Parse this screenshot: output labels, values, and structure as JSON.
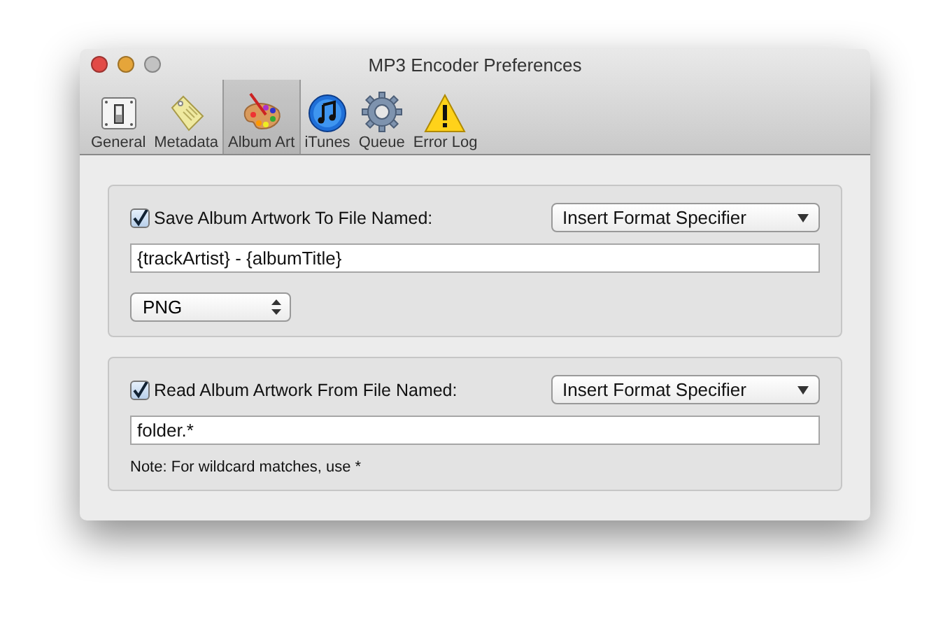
{
  "window": {
    "title": "MP3 Encoder Preferences"
  },
  "toolbar": {
    "items": [
      {
        "label": "General",
        "kind": "switch",
        "selected": false
      },
      {
        "label": "Metadata",
        "kind": "tag",
        "selected": false
      },
      {
        "label": "Album Art",
        "kind": "palette",
        "selected": true
      },
      {
        "label": "iTunes",
        "kind": "music",
        "selected": false
      },
      {
        "label": "Queue",
        "kind": "gear",
        "selected": false
      },
      {
        "label": "Error Log",
        "kind": "warning",
        "selected": false
      }
    ]
  },
  "sections": [
    {
      "checkbox": {
        "label": "Save Album Artwork To File Named:",
        "checked": true
      },
      "format_menu": {
        "label": "Insert Format Specifier"
      },
      "name_field": {
        "value": "{trackArtist} - {albumTitle}"
      },
      "format_popup": {
        "value": "PNG"
      }
    },
    {
      "checkbox": {
        "label": "Read Album Artwork From File Named:",
        "checked": true
      },
      "format_menu": {
        "label": "Insert Format Specifier"
      },
      "name_field": {
        "value": "folder.*"
      },
      "note": "Note: For wildcard matches, use *"
    }
  ]
}
